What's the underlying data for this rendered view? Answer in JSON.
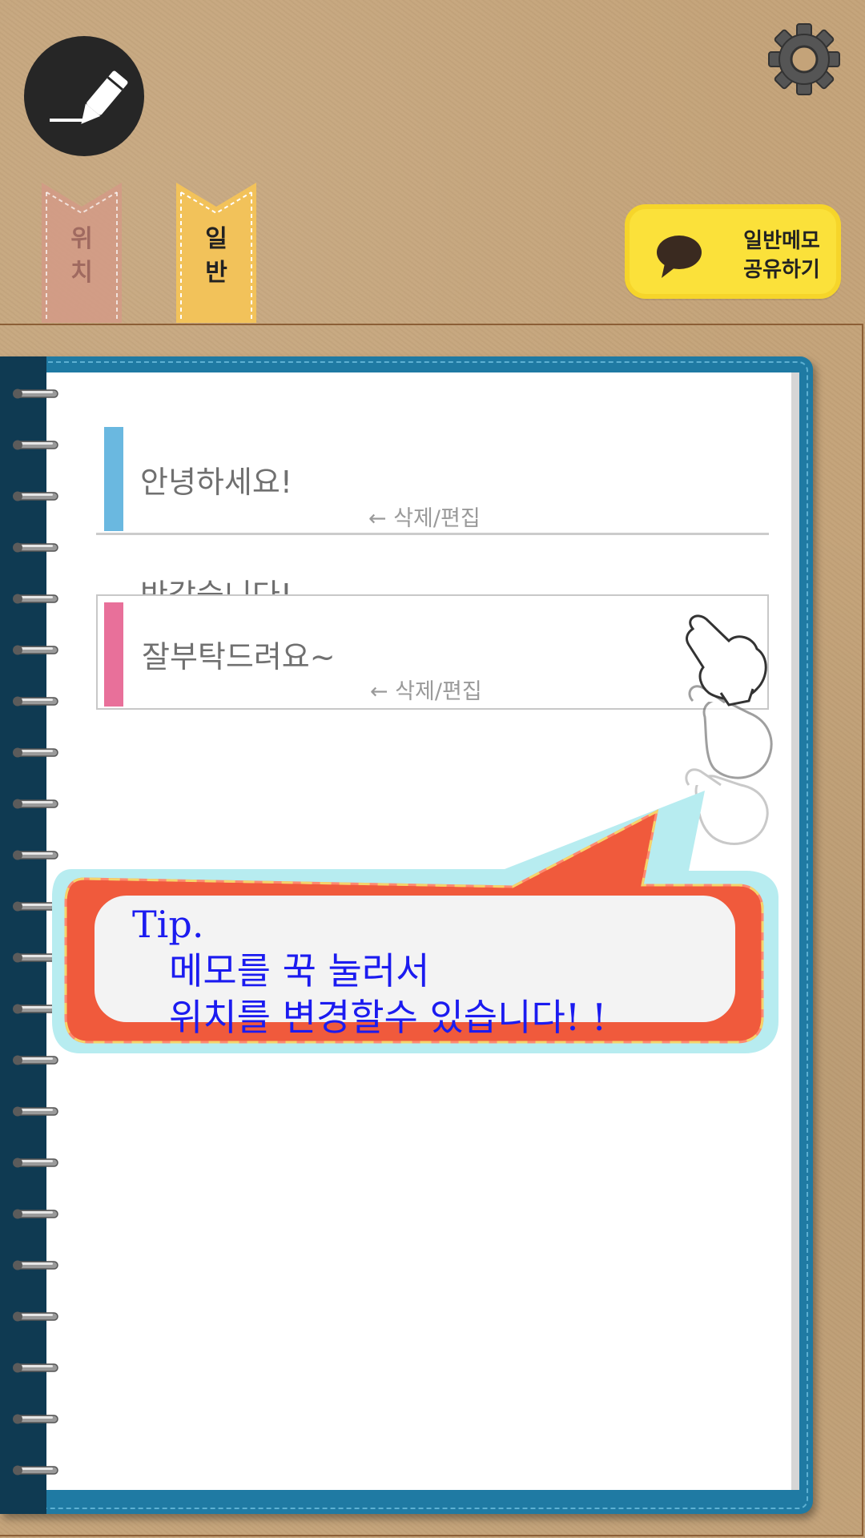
{
  "toolbar": {
    "write_icon": "pen-icon",
    "settings_icon": "gear-icon"
  },
  "ribbons": [
    {
      "label_top": "위",
      "label_bottom": "치",
      "color": "#d9a08a"
    },
    {
      "label_top": "일",
      "label_bottom": "반",
      "color": "#f2c25a"
    }
  ],
  "share": {
    "line1": "일반메모",
    "line2": "공유하기",
    "icon": "chat-bubble-icon",
    "color": "#fbe13a"
  },
  "memos": [
    {
      "title": "안녕하세요!",
      "hint": "← 삭제/편집",
      "color": "#6ab8e0"
    },
    {
      "title": "잘부탁드려요~",
      "hint": "← 삭제/편집",
      "color": "#e8709a"
    }
  ],
  "ghost_memo": {
    "title": "반갑습니다!"
  },
  "tip": {
    "line1": "Tip.",
    "line2": "메모를 꾹 눌러서",
    "line3": "위치를 변경할수 있습니다! !"
  }
}
